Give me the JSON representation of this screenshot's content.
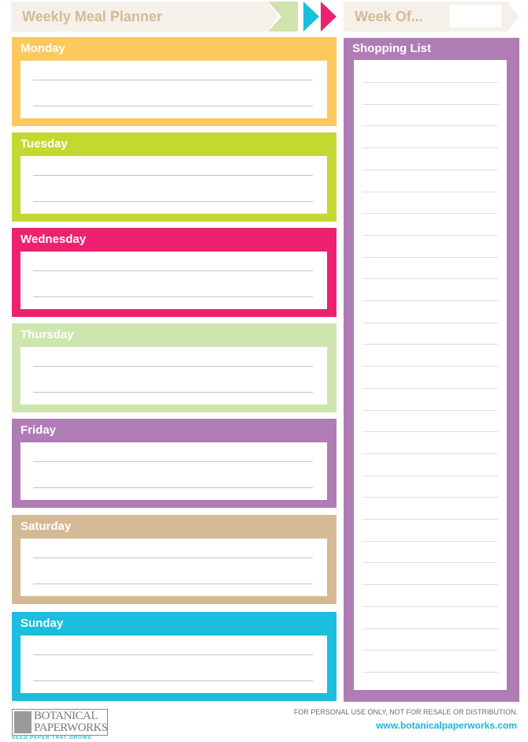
{
  "header": {
    "title": "Weekly Meal Planner",
    "week_of_label": "Week Of...",
    "week_of_value": "",
    "arrow_colors": [
      "#cfe3aa",
      "#18bfdd",
      "#ee2171"
    ]
  },
  "days": [
    {
      "label": "Monday",
      "color": "#fcc95c",
      "lines": 2
    },
    {
      "label": "Tuesday",
      "color": "#c3d932",
      "lines": 2
    },
    {
      "label": "Wednesday",
      "color": "#ee2171",
      "lines": 2
    },
    {
      "label": "Thursday",
      "color": "#cfe5b0",
      "lines": 2
    },
    {
      "label": "Friday",
      "color": "#b07cb6",
      "lines": 2
    },
    {
      "label": "Saturday",
      "color": "#d3ba94",
      "lines": 2
    },
    {
      "label": "Sunday",
      "color": "#1bbfdd",
      "lines": 2
    }
  ],
  "shopping_list": {
    "label": "Shopping List",
    "color": "#b07cb6",
    "line_count": 28
  },
  "footer": {
    "logo_line1": "BOTANICAL",
    "logo_line2": "PAPERWORKS",
    "tagline": "SEED PAPER THAT GROWS",
    "disclaimer": "FOR PERSONAL USE ONLY, NOT FOR RESALE OR DISTRIBUTION.",
    "url": "www.botanicalpaperworks.com"
  }
}
